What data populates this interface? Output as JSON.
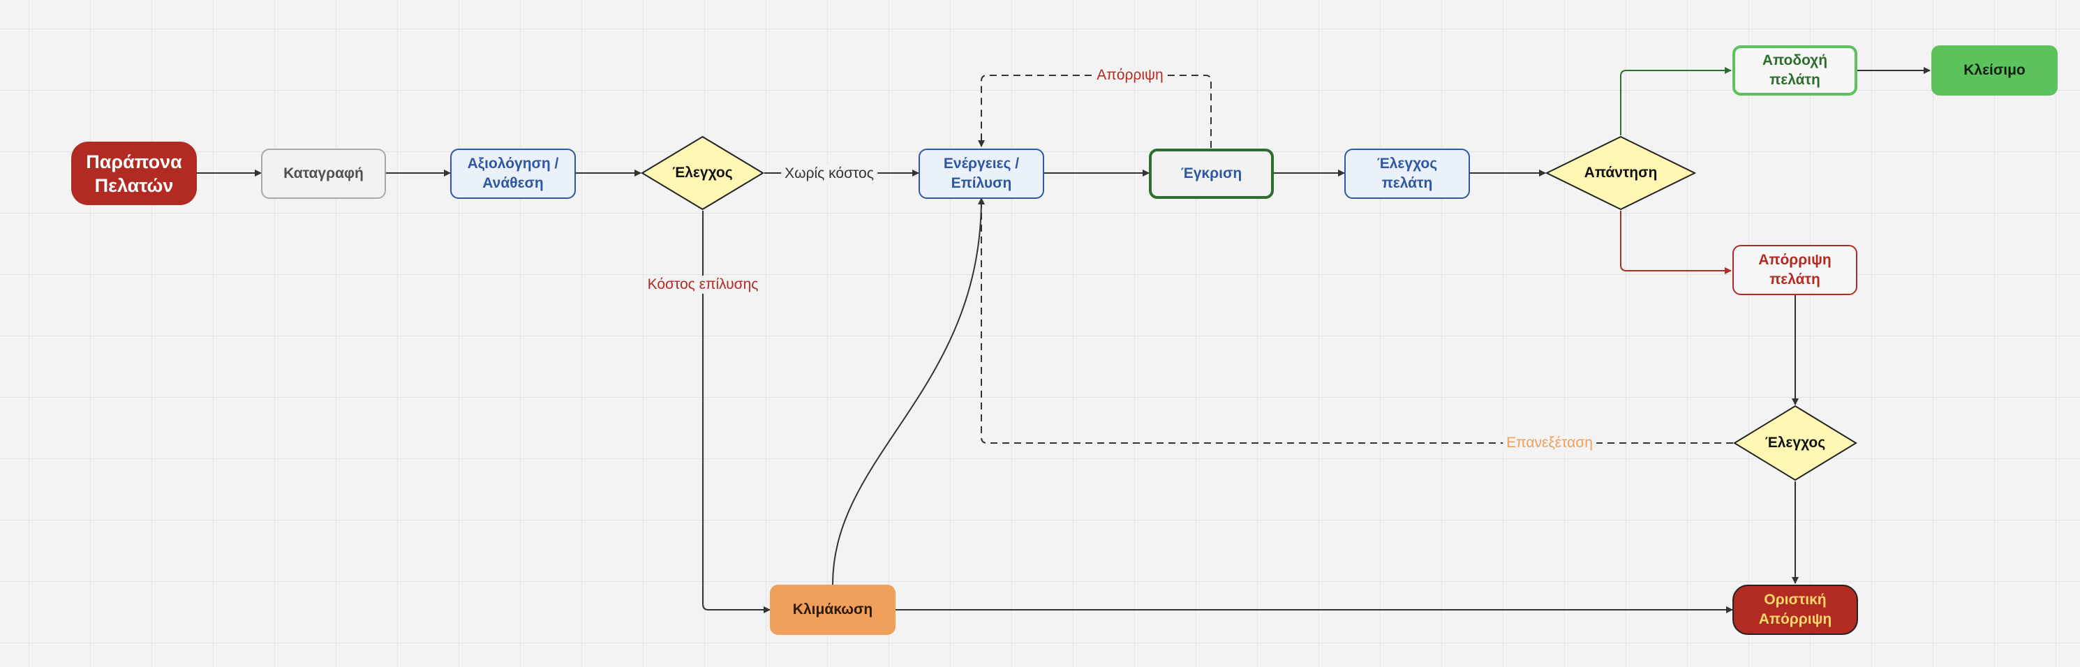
{
  "nodes": {
    "complaint": "Παράπονα Πελατών",
    "registration": "Καταγραφή",
    "assessment": "Αξιολόγηση / Ανάθεση",
    "check1": "Έλεγχος",
    "actions": "Ενέργειες / Επίλυση",
    "approval": "Έγκριση",
    "customer_check": "Έλεγχος πελάτη",
    "response": "Απάντηση",
    "customer_accept": "Αποδοχή πελάτη",
    "close": "Κλείσιμο",
    "customer_reject": "Απόρριψη πελάτη",
    "check2": "Έλεγχος",
    "escalation": "Κλιμάκωση",
    "final_reject": "Οριστική Απόρριψη"
  },
  "edge_labels": {
    "no_cost": "Χωρίς κόστος",
    "resolution_cost": "Κόστος επίλυσης",
    "rejection": "Απόρριψη",
    "reexamination": "Επανεξέταση"
  },
  "colors": {
    "start_red": "#b22b22",
    "process_blue": "#2e57a3",
    "decision_yellow": "#fff7b3",
    "approve_green": "#2c6e2c",
    "accept_green": "#5cc25c",
    "escalation_orange": "#f0a05a",
    "final_text_yellow": "#ffd76a"
  }
}
